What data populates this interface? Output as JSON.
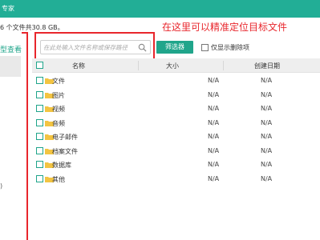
{
  "app": {
    "title": "专家"
  },
  "summary": {
    "text": "6 个文件共30.8 GB。"
  },
  "annotation": {
    "text": "在这里可以精准定位目标文件"
  },
  "sidebar": {
    "view_label": "型查看",
    "paren": ")"
  },
  "search": {
    "placeholder": "在此处输入文件名称或保存路径"
  },
  "toolbar": {
    "filter_label": "筛选器",
    "show_deleted_label": "仅显示删除项"
  },
  "table": {
    "columns": {
      "name": "名称",
      "size": "大小",
      "date": "创建日期"
    },
    "rows": [
      {
        "name": "文件",
        "size": "N/A",
        "date": "N/A"
      },
      {
        "name": "图片",
        "size": "N/A",
        "date": "N/A"
      },
      {
        "name": "视频",
        "size": "N/A",
        "date": "N/A"
      },
      {
        "name": "音频",
        "size": "N/A",
        "date": "N/A"
      },
      {
        "name": "电子邮件",
        "size": "N/A",
        "date": "N/A"
      },
      {
        "name": "档案文件",
        "size": "N/A",
        "date": "N/A"
      },
      {
        "name": "数据库",
        "size": "N/A",
        "date": "N/A"
      },
      {
        "name": "其他",
        "size": "N/A",
        "date": "N/A"
      }
    ]
  },
  "colors": {
    "accent": "#20a58b",
    "annotation": "#e8262c",
    "folder": "#f3c442"
  }
}
